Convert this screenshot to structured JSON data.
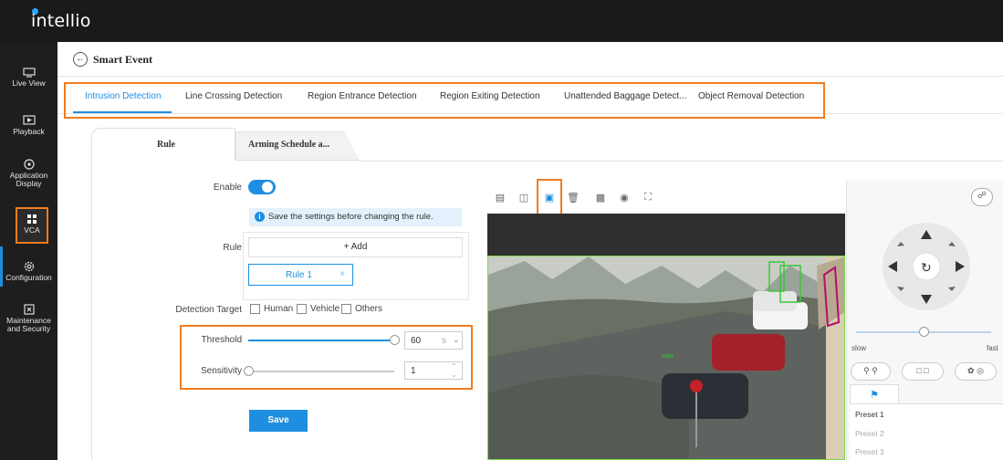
{
  "app": {
    "logo": "intellio"
  },
  "sidebar": {
    "items": [
      {
        "label": "Live View"
      },
      {
        "label": "Playback"
      },
      {
        "label": "Application Display"
      },
      {
        "label": "VCA"
      },
      {
        "label": "Configuration"
      },
      {
        "label": "Maintenance and Security"
      }
    ]
  },
  "header": {
    "title": "Smart Event"
  },
  "tabs": [
    {
      "label": "Intrusion Detection"
    },
    {
      "label": "Line Crossing Detection"
    },
    {
      "label": "Region Entrance Detection"
    },
    {
      "label": "Region Exiting Detection"
    },
    {
      "label": "Unattended Baggage Detect..."
    },
    {
      "label": "Object Removal Detection"
    }
  ],
  "subtabs": [
    {
      "label": "Rule"
    },
    {
      "label": "Arming Schedule a..."
    }
  ],
  "form": {
    "enable_label": "Enable",
    "info_text": "Save the settings before changing the rule.",
    "rule_label": "Rule",
    "add_label": "+ Add",
    "rule_chip": "Rule 1",
    "rule_chip_close": "×",
    "detection_target_label": "Detection Target",
    "targets": [
      {
        "label": "Human"
      },
      {
        "label": "Vehicle"
      },
      {
        "label": "Others"
      }
    ],
    "threshold_label": "Threshold",
    "threshold_value": "60",
    "threshold_unit": "s",
    "threshold_level": 1.0,
    "sensitivity_label": "Sensitivity",
    "sensitivity_value": "1",
    "sensitivity_level": 0.0,
    "save_label": "Save"
  },
  "video": {
    "overlay_text": "mtbx"
  },
  "ptz": {
    "slow_label": "slow",
    "fast_label": "fast",
    "speed_level": 0.5,
    "presets": [
      {
        "label": "Preset 1"
      },
      {
        "label": "Preset 2"
      },
      {
        "label": "Preset 3"
      }
    ]
  },
  "colors": {
    "accent": "#1e8ee0",
    "highlight": "#f07c20",
    "sidebar": "#1e1e1e"
  }
}
